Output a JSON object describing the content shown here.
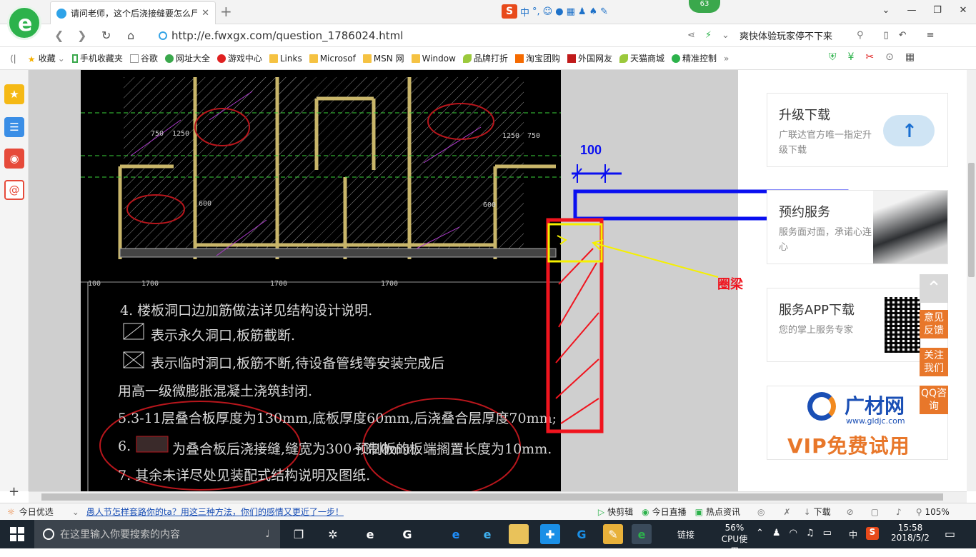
{
  "browser": {
    "tab_title": "请问老师，这个后浇接缝要怎么尸",
    "tab_close": "✕",
    "new_tab": "+",
    "badge_count": "63",
    "ime_label": "中",
    "ime_punct": "°,",
    "address": "http://e.fwxgx.com/question_1786024.html",
    "search_text": "爽快体验玩家停不下来",
    "window_buttons": [
      "⌄",
      "—",
      "❐",
      "✕"
    ]
  },
  "bookmarks": [
    {
      "label": "收藏",
      "icon": "star-icon"
    },
    {
      "label": "手机收藏夹",
      "icon": "phone-icon"
    },
    {
      "label": "谷歌",
      "icon": "page-icon"
    },
    {
      "label": "网址大全",
      "icon": "globe-icon"
    },
    {
      "label": "游戏中心",
      "icon": "game-icon"
    },
    {
      "label": "Links",
      "icon": "folder-icon"
    },
    {
      "label": "Microsof",
      "icon": "folder-icon"
    },
    {
      "label": "MSN 网",
      "icon": "folder-icon"
    },
    {
      "label": "Window",
      "icon": "folder-icon"
    },
    {
      "label": "品牌打折",
      "icon": "leaf-icon"
    },
    {
      "label": "淘宝团购",
      "icon": "taobao-icon"
    },
    {
      "label": "外国网友",
      "icon": "bookmark-icon"
    },
    {
      "label": "天猫商城",
      "icon": "leaf-icon"
    },
    {
      "label": "精准控制",
      "icon": "wechat-icon"
    }
  ],
  "bookmarks_more": "»",
  "annotation": {
    "dimension": "100",
    "label": "圈梁"
  },
  "cad_notes": {
    "line1": "4. 楼板洞口边加筋做法详见结构设计说明.",
    "line2": "表示永久洞口,板筋截断.",
    "line3": "表示临时洞口,板筋不断,待设备管线等安装完成后",
    "line4": "用高一级微膨胀混凝土浇筑封闭.",
    "line5": "5.3-11层叠合板厚度为130mm,底板厚度60mm,后浇叠合层厚度70mm;",
    "line6a": "6.",
    "line6b": "为叠合板后浇接缝,缝宽为300~320mm,",
    "line6c": "预制板的板端搁置长度为10mm.",
    "line7": "7. 其余未详尽处见装配式结构说明及图纸.",
    "dims": [
      "750",
      "1250",
      "1250",
      "750",
      "600",
      "600",
      "1700",
      "1700",
      "1700",
      "100"
    ]
  },
  "right_panel": [
    {
      "title": "升级下载",
      "subtitle": "广联达官方唯一指定升级下载"
    },
    {
      "title": "预约服务",
      "subtitle": "服务面对面，承诺心连心"
    },
    {
      "title": "服务APP下载",
      "subtitle": "您的掌上服务专家"
    }
  ],
  "ad": {
    "brand": "广材网",
    "url": "www.gldjc.com",
    "promo": "VIP免费试用"
  },
  "float_buttons": [
    "意见反馈",
    "关注我们",
    "QQ咨询"
  ],
  "status_bar": {
    "today": "今日优选",
    "headline": "愚人节怎样套路你的ta？用这三种方法，你们的感情又更近了一步！",
    "items": [
      "快剪辑",
      "今日直播",
      "热点资讯",
      "下载"
    ],
    "zoom": "105%"
  },
  "taskbar": {
    "search_placeholder": "在这里输入你要搜索的内容",
    "link": "链接",
    "cpu_value": "56%",
    "cpu_label": "CPU使用",
    "lang": "中",
    "time": "15:58",
    "date": "2018/5/2"
  },
  "colors": {
    "blue_box": "#0a0ff0",
    "red_box": "#f0141e",
    "yellow": "#f5f000",
    "accent_orange": "#e8772a"
  }
}
